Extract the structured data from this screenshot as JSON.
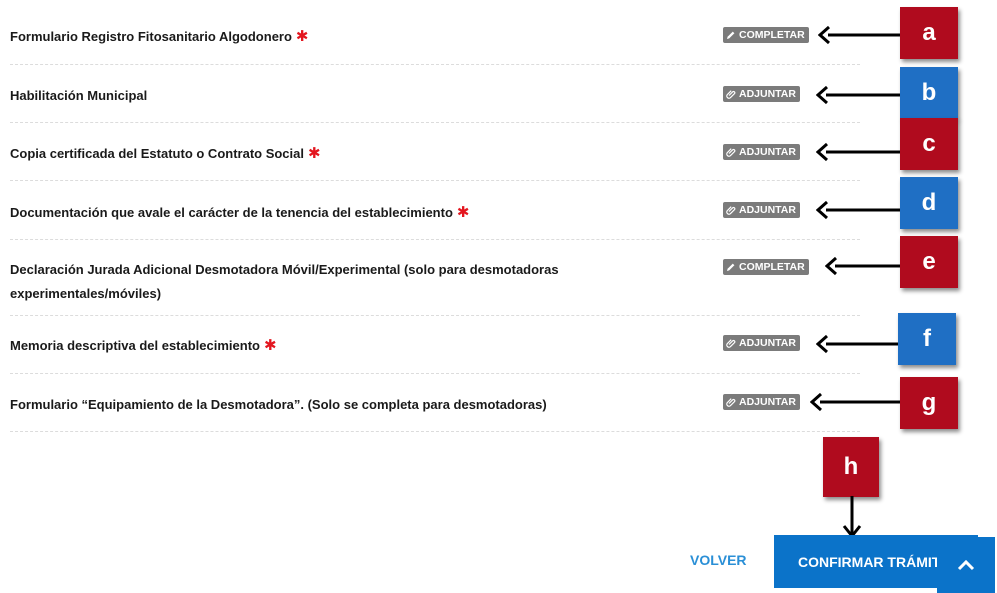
{
  "items": [
    {
      "label": "Formulario Registro Fitosanitario Algodonero",
      "required": "✱",
      "action": "COMPLETAR",
      "tag": "a"
    },
    {
      "label": "Habilitación Municipal",
      "required": "",
      "action": "ADJUNTAR",
      "tag": "b"
    },
    {
      "label": "Copia certificada del Estatuto o Contrato Social",
      "required": "✱",
      "action": "ADJUNTAR",
      "tag": "c"
    },
    {
      "label": "Documentación que avale el carácter de la tenencia del establecimiento",
      "required": "✱",
      "action": "ADJUNTAR",
      "tag": "d"
    },
    {
      "label_line1": "Declaración Jurada Adicional Desmotadora Móvil/Experimental (solo para desmotadoras",
      "label_line2": "experimentales/móviles)",
      "required": "",
      "action": "COMPLETAR",
      "tag": "e"
    },
    {
      "label": "Memoria descriptiva del establecimiento",
      "required": "✱",
      "action": "ADJUNTAR",
      "tag": "f"
    },
    {
      "label": "Formulario “Equipamiento de la Desmotadora”. (Solo se completa para desmotadoras)",
      "required": "",
      "action": "ADJUNTAR",
      "tag": "g"
    }
  ],
  "footer": {
    "back": "VOLVER",
    "confirm": "CONFIRMAR TRÁMITE",
    "tag": "h"
  },
  "colors": {
    "tag_red": "#b00b1e",
    "tag_blue": "#1f6fc4",
    "button_blue": "#0b73c9",
    "link_blue": "#2a8fd6",
    "required_red": "#e3161f",
    "pill_grey": "#7b7b7b"
  },
  "icons": {
    "complete": "pencil-icon",
    "attach": "paperclip-icon",
    "scroll_top": "chevron-up-icon"
  }
}
